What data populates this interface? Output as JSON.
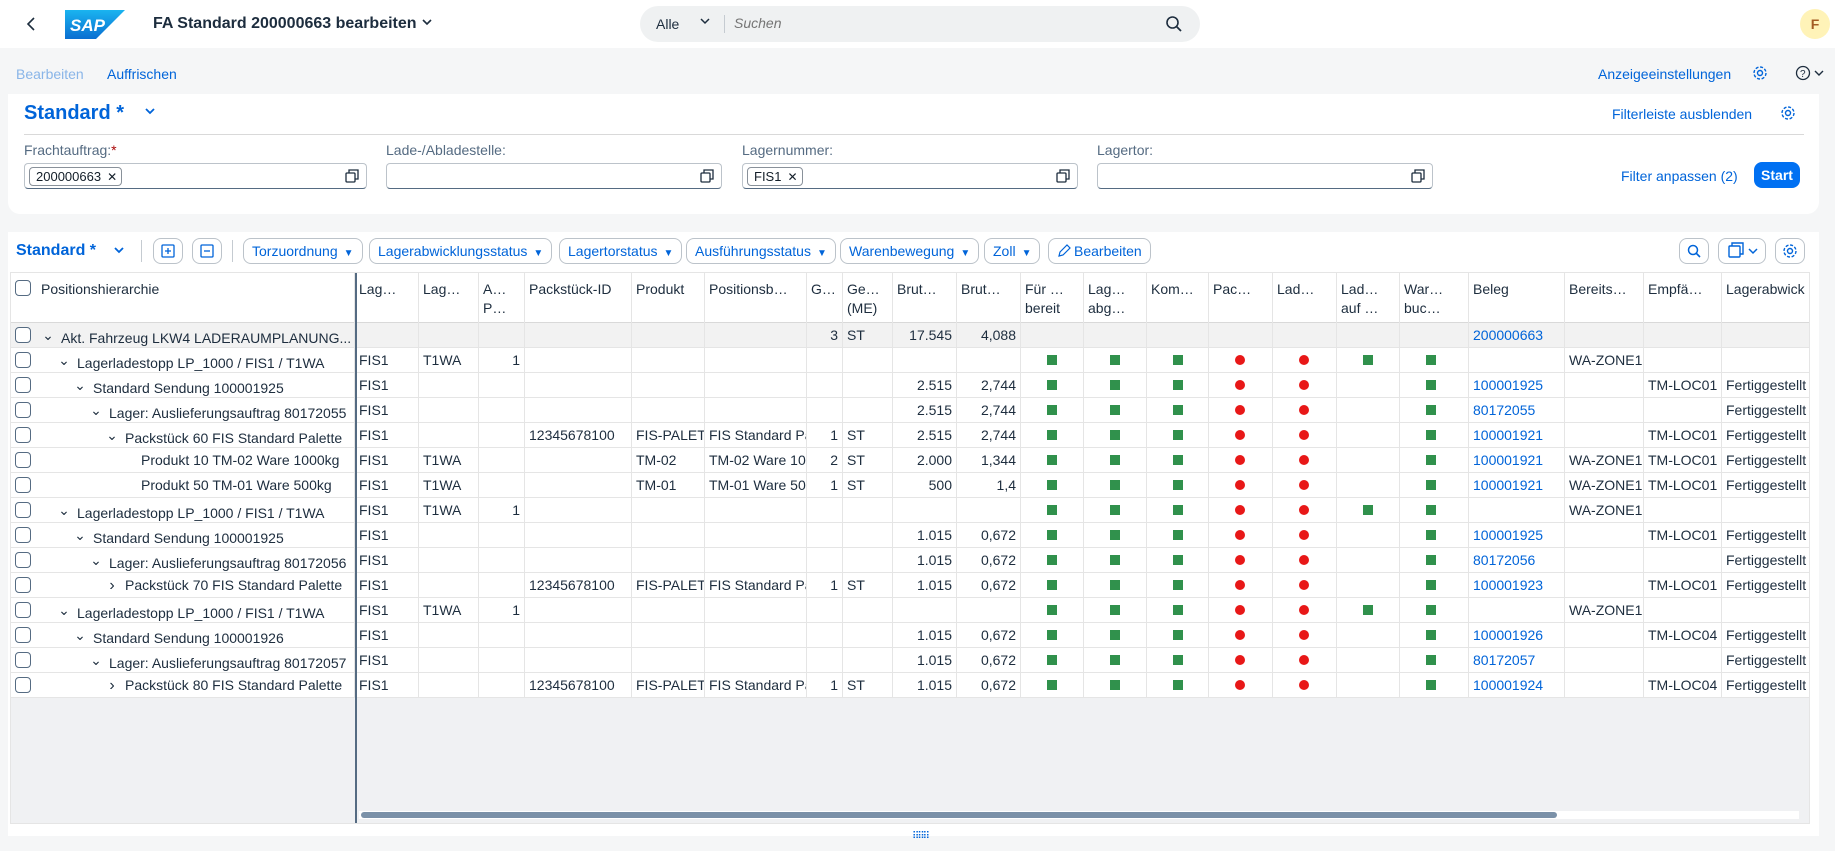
{
  "shell": {
    "title": "FA Standard 200000663 bearbeiten",
    "logo_text": "SAP",
    "search_scope": "Alle",
    "search_placeholder": "Suchen",
    "avatar_initial": "F"
  },
  "toolbar": {
    "edit_label": "Bearbeiten",
    "refresh_label": "Auffrischen",
    "display_settings_label": "Anzeigeeinstellungen"
  },
  "filterbar": {
    "variant": "Standard *",
    "hide_label": "Filterleiste ausblenden",
    "adapt_label": "Filter anpassen (2)",
    "start_label": "Start",
    "fields": [
      {
        "label": "Frachtauftrag:",
        "required": "*",
        "token": "200000663"
      },
      {
        "label": "Lade-/Abladestelle:",
        "required": "",
        "token": ""
      },
      {
        "label": "Lagernummer:",
        "required": "",
        "token": "FIS1"
      },
      {
        "label": "Lagertor:",
        "required": "",
        "token": ""
      }
    ]
  },
  "table": {
    "variant": "Standard *",
    "menus": [
      "Torzuordnung",
      "Lagerabwicklungsstatus",
      "Lagertorstatus",
      "Ausführungsstatus",
      "Warenbewegung",
      "Zoll"
    ],
    "edit_button": "Bearbeiten",
    "columns": [
      "Positionshierarchie",
      "Lag…",
      "Lag…",
      "A… P…",
      "Packstück-ID",
      "Produkt",
      "Positionsb…",
      "G…",
      "Ge… (ME)",
      "Brut…",
      "Brut…",
      "Für … bereit",
      "Lag… abg…",
      "Kom…",
      "Pac…",
      "Lad…",
      "Lad… auf …",
      "War… buc…",
      "Beleg",
      "Bereits…",
      "Empfä…",
      "Lagerabwick"
    ],
    "rows": [
      {
        "indent": 0,
        "toggle": "v",
        "hier": "Akt. Fahrzeug LKW4 LADERAUMPLANUNG...",
        "c1": "",
        "c2": "",
        "c3": "",
        "c4": "",
        "c5": "",
        "c6": "",
        "c7": "3",
        "c8": "ST",
        "c9": "17.545",
        "c10": "4,088",
        "s": [
          "",
          "",
          "",
          "",
          "",
          "",
          ""
        ],
        "beleg": "200000663",
        "c19": "",
        "c20": "",
        "c21": "",
        "sum": true
      },
      {
        "indent": 1,
        "toggle": "v",
        "hier": "Lagerladestopp LP_1000 / FIS1 / T1WA",
        "c1": "FIS1",
        "c2": "T1WA",
        "c3": "1",
        "c4": "",
        "c5": "",
        "c6": "",
        "c7": "",
        "c8": "",
        "c9": "",
        "c10": "",
        "s": [
          "g",
          "g",
          "g",
          "r",
          "r",
          "g",
          "g"
        ],
        "beleg": "",
        "c19": "WA-ZONE1",
        "c20": "",
        "c21": ""
      },
      {
        "indent": 2,
        "toggle": "v",
        "hier": "Standard Sendung 100001925",
        "c1": "FIS1",
        "c2": "",
        "c3": "",
        "c4": "",
        "c5": "",
        "c6": "",
        "c7": "",
        "c8": "",
        "c9": "2.515",
        "c10": "2,744",
        "s": [
          "g",
          "g",
          "g",
          "r",
          "r",
          "",
          "g"
        ],
        "beleg": "100001925",
        "c19": "",
        "c20": "TM-LOC01",
        "c21": "Fertiggestellt"
      },
      {
        "indent": 3,
        "toggle": "v",
        "hier": "Lager: Auslieferungsauftrag 80172055",
        "c1": "FIS1",
        "c2": "",
        "c3": "",
        "c4": "",
        "c5": "",
        "c6": "",
        "c7": "",
        "c8": "",
        "c9": "2.515",
        "c10": "2,744",
        "s": [
          "g",
          "g",
          "g",
          "r",
          "r",
          "",
          "g"
        ],
        "beleg": "80172055",
        "c19": "",
        "c20": "",
        "c21": "Fertiggestellt"
      },
      {
        "indent": 4,
        "toggle": "v",
        "hier": "Packstück 60 FIS Standard Palette",
        "c1": "FIS1",
        "c2": "",
        "c3": "",
        "c4": "12345678100",
        "c5": "FIS-PALETTE",
        "c6": "FIS Standard Palette",
        "c7": "1",
        "c8": "ST",
        "c9": "2.515",
        "c10": "2,744",
        "s": [
          "g",
          "g",
          "g",
          "r",
          "r",
          "",
          "g"
        ],
        "beleg": "100001921",
        "c19": "",
        "c20": "TM-LOC01",
        "c21": "Fertiggestellt"
      },
      {
        "indent": 5,
        "toggle": "",
        "hier": "Produkt 10 TM-02 Ware 1000kg",
        "c1": "FIS1",
        "c2": "T1WA",
        "c3": "",
        "c4": "",
        "c5": "TM-02",
        "c6": "TM-02 Ware 1000kg",
        "c7": "2",
        "c8": "ST",
        "c9": "2.000",
        "c10": "1,344",
        "s": [
          "g",
          "g",
          "g",
          "r",
          "r",
          "",
          "g"
        ],
        "beleg": "100001921",
        "c19": "WA-ZONE1",
        "c20": "TM-LOC01",
        "c21": "Fertiggestellt"
      },
      {
        "indent": 5,
        "toggle": "",
        "hier": "Produkt 50 TM-01 Ware 500kg",
        "c1": "FIS1",
        "c2": "T1WA",
        "c3": "",
        "c4": "",
        "c5": "TM-01",
        "c6": "TM-01 Ware 500kg",
        "c7": "1",
        "c8": "ST",
        "c9": "500",
        "c10": "1,4",
        "s": [
          "g",
          "g",
          "g",
          "r",
          "r",
          "",
          "g"
        ],
        "beleg": "100001921",
        "c19": "WA-ZONE1",
        "c20": "TM-LOC01",
        "c21": "Fertiggestellt"
      },
      {
        "indent": 1,
        "toggle": "v",
        "hier": "Lagerladestopp LP_1000 / FIS1 / T1WA",
        "c1": "FIS1",
        "c2": "T1WA",
        "c3": "1",
        "c4": "",
        "c5": "",
        "c6": "",
        "c7": "",
        "c8": "",
        "c9": "",
        "c10": "",
        "s": [
          "g",
          "g",
          "g",
          "r",
          "r",
          "g",
          "g"
        ],
        "beleg": "",
        "c19": "WA-ZONE1",
        "c20": "",
        "c21": ""
      },
      {
        "indent": 2,
        "toggle": "v",
        "hier": "Standard Sendung 100001925",
        "c1": "FIS1",
        "c2": "",
        "c3": "",
        "c4": "",
        "c5": "",
        "c6": "",
        "c7": "",
        "c8": "",
        "c9": "1.015",
        "c10": "0,672",
        "s": [
          "g",
          "g",
          "g",
          "r",
          "r",
          "",
          "g"
        ],
        "beleg": "100001925",
        "c19": "",
        "c20": "TM-LOC01",
        "c21": "Fertiggestellt"
      },
      {
        "indent": 3,
        "toggle": "v",
        "hier": "Lager: Auslieferungsauftrag 80172056",
        "c1": "FIS1",
        "c2": "",
        "c3": "",
        "c4": "",
        "c5": "",
        "c6": "",
        "c7": "",
        "c8": "",
        "c9": "1.015",
        "c10": "0,672",
        "s": [
          "g",
          "g",
          "g",
          "r",
          "r",
          "",
          "g"
        ],
        "beleg": "80172056",
        "c19": "",
        "c20": "",
        "c21": "Fertiggestellt"
      },
      {
        "indent": 4,
        "toggle": ">",
        "hier": "Packstück 70 FIS Standard Palette",
        "c1": "FIS1",
        "c2": "",
        "c3": "",
        "c4": "12345678100",
        "c5": "FIS-PALETTE",
        "c6": "FIS Standard Palette",
        "c7": "1",
        "c8": "ST",
        "c9": "1.015",
        "c10": "0,672",
        "s": [
          "g",
          "g",
          "g",
          "r",
          "r",
          "",
          "g"
        ],
        "beleg": "100001923",
        "c19": "",
        "c20": "TM-LOC01",
        "c21": "Fertiggestellt"
      },
      {
        "indent": 1,
        "toggle": "v",
        "hier": "Lagerladestopp LP_1000 / FIS1 / T1WA",
        "c1": "FIS1",
        "c2": "T1WA",
        "c3": "1",
        "c4": "",
        "c5": "",
        "c6": "",
        "c7": "",
        "c8": "",
        "c9": "",
        "c10": "",
        "s": [
          "g",
          "g",
          "g",
          "r",
          "r",
          "g",
          "g"
        ],
        "beleg": "",
        "c19": "WA-ZONE1",
        "c20": "",
        "c21": ""
      },
      {
        "indent": 2,
        "toggle": "v",
        "hier": "Standard Sendung 100001926",
        "c1": "FIS1",
        "c2": "",
        "c3": "",
        "c4": "",
        "c5": "",
        "c6": "",
        "c7": "",
        "c8": "",
        "c9": "1.015",
        "c10": "0,672",
        "s": [
          "g",
          "g",
          "g",
          "r",
          "r",
          "",
          "g"
        ],
        "beleg": "100001926",
        "c19": "",
        "c20": "TM-LOC04",
        "c21": "Fertiggestellt"
      },
      {
        "indent": 3,
        "toggle": "v",
        "hier": "Lager: Auslieferungsauftrag 80172057",
        "c1": "FIS1",
        "c2": "",
        "c3": "",
        "c4": "",
        "c5": "",
        "c6": "",
        "c7": "",
        "c8": "",
        "c9": "1.015",
        "c10": "0,672",
        "s": [
          "g",
          "g",
          "g",
          "r",
          "r",
          "",
          "g"
        ],
        "beleg": "80172057",
        "c19": "",
        "c20": "",
        "c21": "Fertiggestellt"
      },
      {
        "indent": 4,
        "toggle": ">",
        "hier": "Packstück 80 FIS Standard Palette",
        "c1": "FIS1",
        "c2": "",
        "c3": "",
        "c4": "12345678100",
        "c5": "FIS-PALETTE",
        "c6": "FIS Standard Palette",
        "c7": "1",
        "c8": "ST",
        "c9": "1.015",
        "c10": "0,672",
        "s": [
          "g",
          "g",
          "g",
          "r",
          "r",
          "",
          "g"
        ],
        "beleg": "100001924",
        "c19": "",
        "c20": "TM-LOC04",
        "c21": "Fertiggestellt"
      }
    ]
  },
  "colors": {
    "accent": "#0064d9",
    "status_ok": "#30914c",
    "status_error": "#e81818"
  }
}
